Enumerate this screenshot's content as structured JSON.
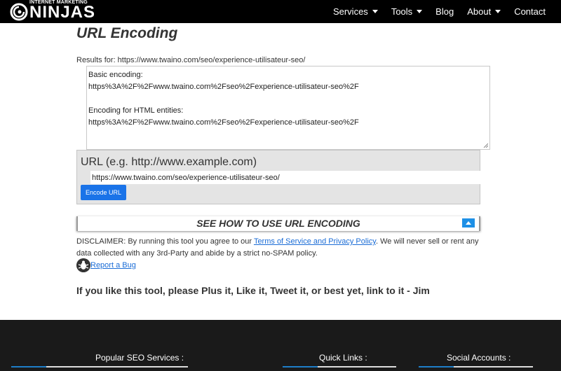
{
  "brand": {
    "small_text": "INTERNET MARKETING",
    "big_text": "NINJAS"
  },
  "nav": {
    "items": [
      {
        "label": "Services",
        "dropdown": true
      },
      {
        "label": "Tools",
        "dropdown": true
      },
      {
        "label": "Blog",
        "dropdown": false
      },
      {
        "label": "About",
        "dropdown": true
      },
      {
        "label": "Contact",
        "dropdown": false
      }
    ]
  },
  "main": {
    "title": "URL Encoding",
    "results_label": "Results for: https://www.twaino.com/seo/experience-utilisateur-seo/",
    "results": {
      "basic_label": "Basic encoding:",
      "basic_value": "https%3A%2F%2Fwww.twaino.com%2Fseo%2Fexperience-utilisateur-seo%2F",
      "html_label": "Encoding for HTML entities:",
      "html_value": "https%3A%2F%2Fwww.twaino.com%2Fseo%2Fexperience-utilisateur-seo%2F"
    },
    "form": {
      "url_label": "URL (e.g. http://www.example.com)",
      "url_value": "https://www.twaino.com/seo/experience-utilisateur-seo/",
      "button_label": "Encode URL"
    },
    "howto": {
      "title": "SEE HOW TO USE URL ENCODING"
    },
    "disclaimer": {
      "prefix": "DISCLAIMER: By running this tool you agree to our ",
      "link": "Terms of Service and Privacy Policy",
      "suffix": ". We will never sell or rent any data collected with any 3rd-Party and abide by a strict no-SPAM policy."
    },
    "bug_link": "Report a Bug",
    "plus_line": "If you like this tool, please Plus it, Like it, Tweet it, or best yet, link to it - Jim"
  },
  "footer": {
    "popular": "Popular SEO Services :",
    "quick": "Quick Links :",
    "social": "Social Accounts :"
  },
  "colors": {
    "accent": "#1a73e8",
    "nav_bg": "#000000",
    "footer_bg": "#1a1a1a",
    "footer_accent": "#1e7ec8"
  }
}
